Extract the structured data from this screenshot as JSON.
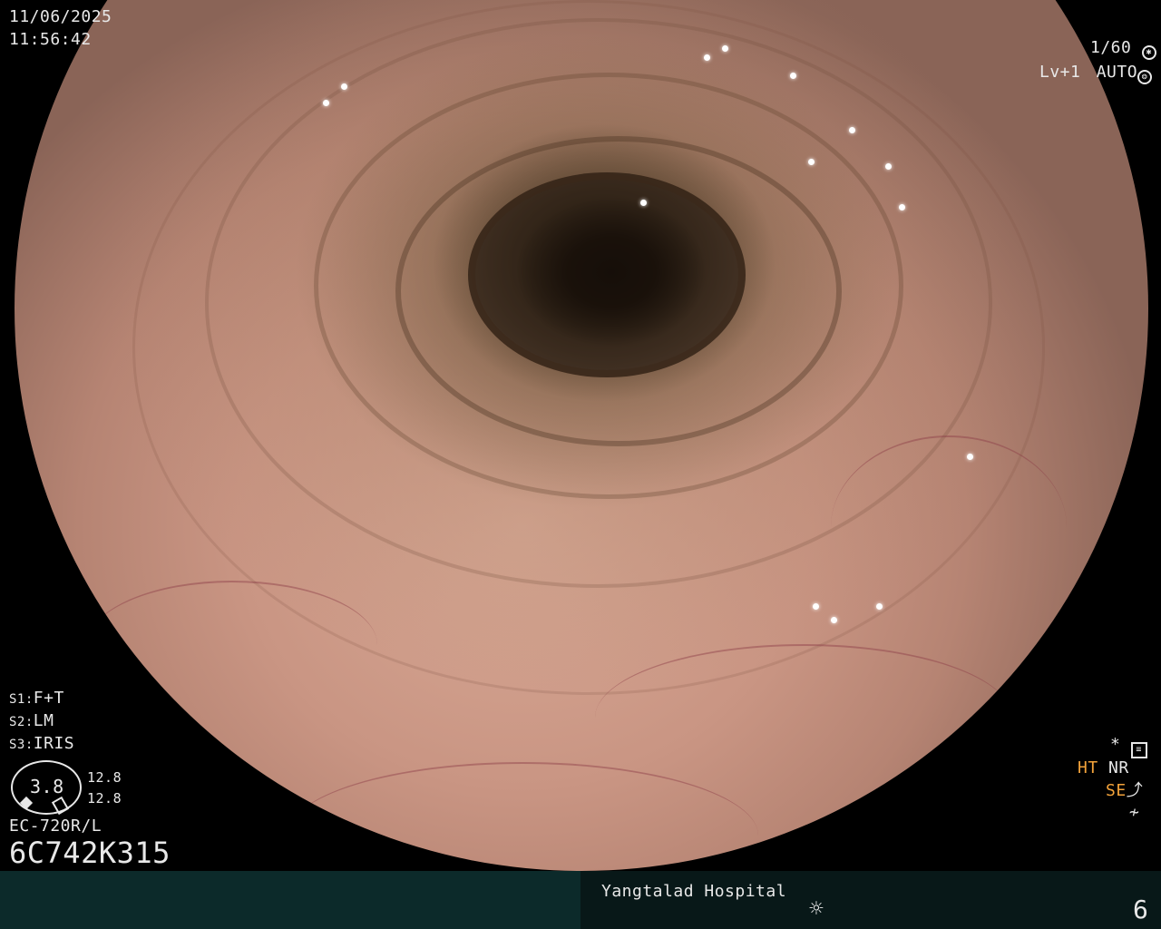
{
  "datetime": {
    "date": "11/06/2025",
    "time": "11:56:42"
  },
  "exposure": {
    "shutter": "1/60",
    "shutter_icon": "aperture-icon",
    "level": "Lv+1",
    "mode": "AUTO",
    "mode_icon": "iris-icon"
  },
  "settings": [
    {
      "key": "S1:",
      "value": "F+T"
    },
    {
      "key": "S2:",
      "value": "LM"
    },
    {
      "key": "S3:",
      "value": "IRIS"
    }
  ],
  "gauge": {
    "value": "3.8",
    "upper": "12.8",
    "lower": "12.8"
  },
  "scope": {
    "model": "EC-720R/L",
    "serial": "6C742K315"
  },
  "indicators": {
    "star": "*",
    "star_icon": "menu-settings-icon",
    "ht": "HT",
    "nr": "NR",
    "se": "SE",
    "se_icon": "enhancement-curve-icon",
    "bottom_icon": "freeze-icon"
  },
  "footer": {
    "hospital": "Yangtalad Hospital",
    "light_icon": "light-sun-icon",
    "page": "6"
  },
  "colors": {
    "highlight": "#f2a23a",
    "osd_text": "#e8e8e8",
    "footer_left": "#0c2a2a",
    "footer_right": "#081818"
  }
}
